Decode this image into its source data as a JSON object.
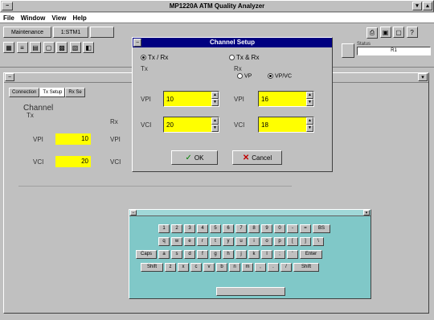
{
  "app": {
    "title": "MP1220A ATM Quality Analyzer"
  },
  "menu": [
    "File",
    "Window",
    "View",
    "Help"
  ],
  "toolbar": {
    "tab1": "Maintenance",
    "tab2": "1:STM1",
    "status_label": "Status",
    "status_value": "R1"
  },
  "inner_tabs": [
    "Connection",
    "Tx Setup",
    "Rx Se"
  ],
  "channel_panel": {
    "title": "Channel",
    "tx": "Tx",
    "rx": "Rx",
    "vpi_label": "VPI",
    "vci_label": "VCI",
    "tx_vpi": "10",
    "tx_vci": "20",
    "rx_vpi": "VPI",
    "rx_vci": "VCI"
  },
  "dialog": {
    "title": "Channel Setup",
    "opt_txrx": "Tx / Rx",
    "opt_txrx2": "Tx & Rx",
    "tx_label": "Tx",
    "rx_label": "Rx",
    "rx_opt_vp": "VP",
    "rx_opt_vpvc": "VP/VC",
    "vpi_label": "VPI",
    "vci_label": "VCI",
    "tx_vpi": "10",
    "tx_vci": "20",
    "rx_vpi": "16",
    "rx_vci": "18",
    "ok": "OK",
    "cancel": "Cancel"
  },
  "keyboard": {
    "row1": [
      "1",
      "2",
      "3",
      "4",
      "5",
      "6",
      "7",
      "8",
      "9",
      "0",
      "-",
      "=",
      "BS"
    ],
    "row2": [
      "q",
      "w",
      "e",
      "r",
      "t",
      "y",
      "u",
      "i",
      "o",
      "p",
      "[",
      "]",
      "\\"
    ],
    "row3": [
      "Caps",
      "a",
      "s",
      "d",
      "f",
      "g",
      "h",
      "j",
      "k",
      "l",
      ";",
      "'",
      "Enter"
    ],
    "row4": [
      "Shift",
      "z",
      "x",
      "c",
      "v",
      "b",
      "n",
      "m",
      ",",
      ".",
      "/",
      "Shift"
    ]
  }
}
